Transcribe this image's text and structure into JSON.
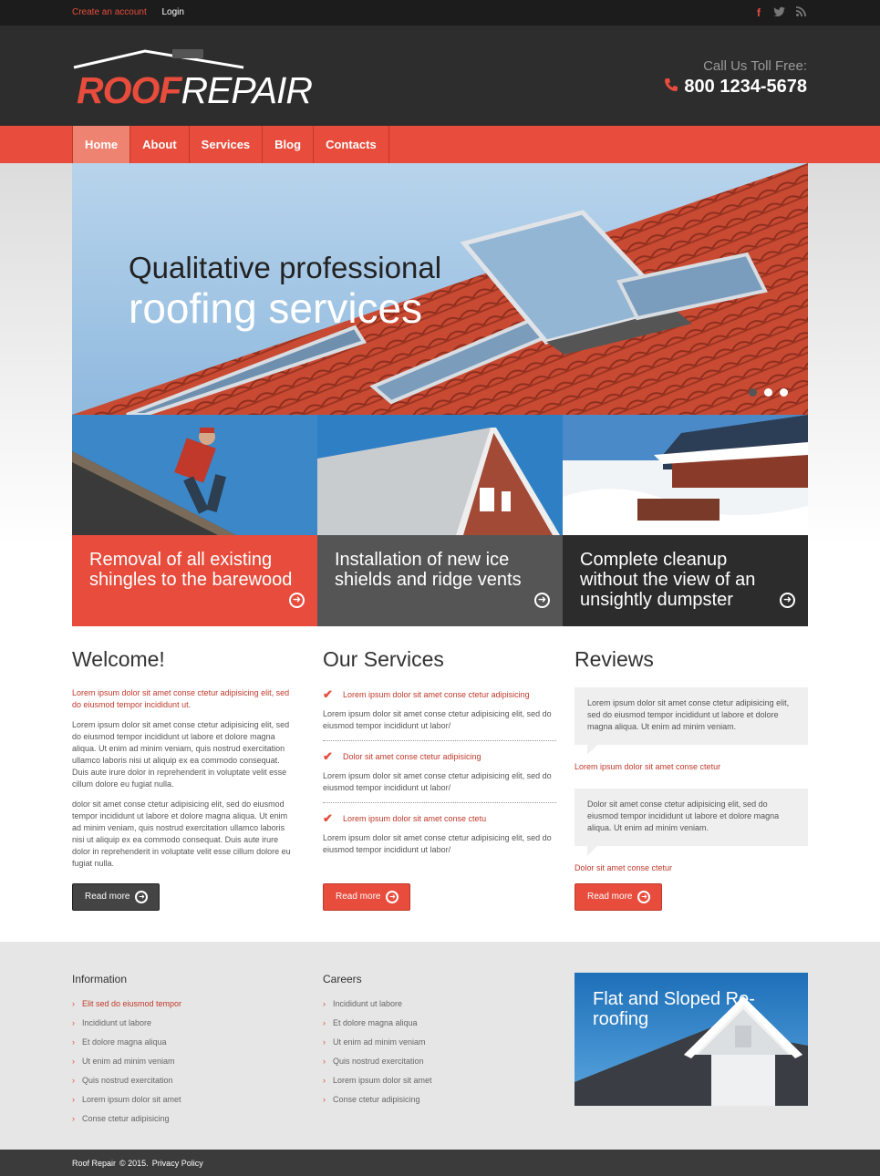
{
  "topbar": {
    "create_account": "Create an account",
    "login": "Login",
    "social": [
      "facebook-icon",
      "twitter-icon",
      "rss-icon"
    ]
  },
  "header": {
    "logo_roof": "ROOF",
    "logo_repair": "REPAIR",
    "call_label": "Call Us Toll Free:",
    "phone": "800 1234-5678"
  },
  "nav": {
    "items": [
      "Home",
      "About",
      "Services",
      "Blog",
      "Contacts"
    ],
    "active": "Home"
  },
  "hero": {
    "line1": "Qualitative professional",
    "line2": "roofing services",
    "slides": 3,
    "active_slide": 1
  },
  "tiles": [
    {
      "caption": "Removal of all existing shingles to the barewood"
    },
    {
      "caption": "Installation of new ice shields and ridge vents"
    },
    {
      "caption": "Complete cleanup without the view of an unsightly dumpster"
    }
  ],
  "welcome": {
    "title": "Welcome!",
    "intro": "Lorem ipsum dolor sit amet conse ctetur adipisicing elit, sed do eiusmod tempor incididunt ut.",
    "p1": "Lorem ipsum dolor sit amet conse ctetur adipisicing elit, sed do eiusmod tempor incididunt ut labore et dolore magna aliqua. Ut enim ad minim veniam, quis nostrud exercitation ullamco laboris nisi ut aliquip ex ea commodo consequat. Duis aute irure dolor in reprehenderit in voluptate velit esse cillum dolore eu fugiat nulla.",
    "p2": "dolor sit amet conse ctetur adipisicing elit, sed do eiusmod tempor incididunt ut labore et dolore magna aliqua. Ut enim ad minim veniam, quis nostrud exercitation ullamco laboris nisi ut aliquip ex ea commodo consequat. Duis aute irure dolor in reprehenderit in voluptate velit esse cillum dolore eu fugiat nulla.",
    "button": "Read more"
  },
  "services": {
    "title": "Our Services",
    "items": [
      {
        "title": "Lorem ipsum dolor sit amet conse ctetur adipisicing",
        "text": "Lorem ipsum dolor sit amet conse ctetur adipisicing elit, sed do eiusmod tempor incididunt ut labor/"
      },
      {
        "title": "Dolor sit amet conse ctetur adipisicing",
        "text": "Lorem ipsum dolor sit amet conse ctetur adipisicing elit, sed do eiusmod tempor incididunt ut labor/"
      },
      {
        "title": "Lorem ipsum dolor sit amet conse ctetu",
        "text": "Lorem ipsum dolor sit amet conse ctetur adipisicing elit, sed do eiusmod tempor incididunt ut labor/"
      }
    ],
    "button": "Read more"
  },
  "reviews": {
    "title": "Reviews",
    "items": [
      {
        "text": "Lorem ipsum dolor sit amet conse ctetur adipisicing elit, sed do eiusmod tempor incididunt ut labore et dolore magna aliqua. Ut enim ad minim veniam.",
        "author": "Lorem ipsum dolor sit amet conse ctetur"
      },
      {
        "text": "Dolor sit amet conse ctetur adipisicing elit, sed do eiusmod tempor incididunt ut labore et dolore magna aliqua. Ut enim ad minim veniam.",
        "author": "Dolor sit amet conse ctetur"
      }
    ],
    "button": "Read more"
  },
  "footer": {
    "information": {
      "title": "Information",
      "items": [
        "Elit sed do eiusmod tempor",
        "Incididunt ut labore",
        "Et dolore magna aliqua",
        "Ut enim ad minim veniam",
        "Quis nostrud exercitation",
        "Lorem ipsum dolor sit amet",
        "Conse ctetur adipisicing"
      ]
    },
    "careers": {
      "title": "Careers",
      "items": [
        "Incididunt ut labore",
        "Et dolore magna aliqua",
        "Ut enim ad minim veniam",
        "Quis nostrud exercitation",
        "Lorem ipsum dolor sit amet",
        "Conse ctetur adipisicing"
      ]
    },
    "promo": "Flat and Sloped Re-roofing"
  },
  "bottom": {
    "brand": "Roof Repair",
    "copyright": "© 2015.",
    "privacy": "Privacy Policy"
  },
  "colors": {
    "accent": "#e74c3c",
    "dark": "#2d2d2d",
    "topbar": "#1c1c1c"
  }
}
